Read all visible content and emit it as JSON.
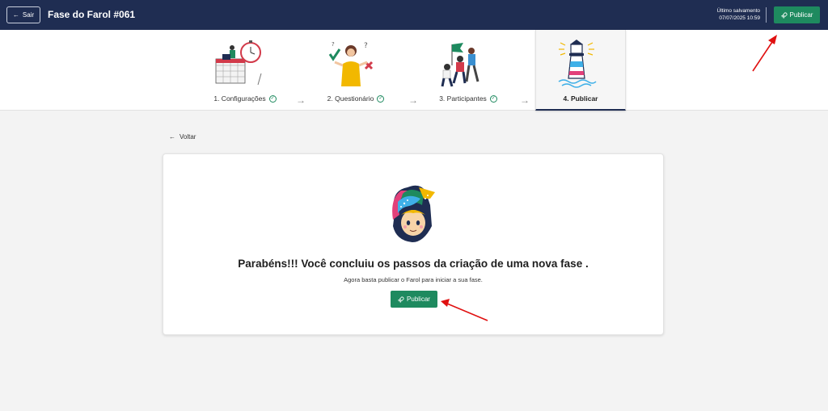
{
  "header": {
    "exit_label": "Sair",
    "title": "Fase do Farol #061",
    "save_label": "Último salvamento",
    "save_time": "07/07/2025 10:59",
    "publish_label": "Publicar"
  },
  "steps": [
    {
      "label": "1. Configurações",
      "completed": true
    },
    {
      "label": "2. Questionário",
      "completed": true
    },
    {
      "label": "3. Participantes",
      "completed": true
    },
    {
      "label": "4. Publicar",
      "completed": false,
      "active": true
    }
  ],
  "main": {
    "back_label": "Voltar",
    "title": "Parabéns!!! Você concluiu os passos da criação de uma nova fase .",
    "subtitle": "Agora basta publicar o Farol para iniciar a sua fase.",
    "publish_label": "Publicar"
  },
  "colors": {
    "header_bg": "#1f2d52",
    "primary_green": "#1e8a5f",
    "annotation_red": "#e01010"
  },
  "icons": {
    "exit": "arrow-left-icon",
    "publish": "rocket-icon",
    "check": "check-circle-icon",
    "separator": "arrow-right-icon"
  }
}
